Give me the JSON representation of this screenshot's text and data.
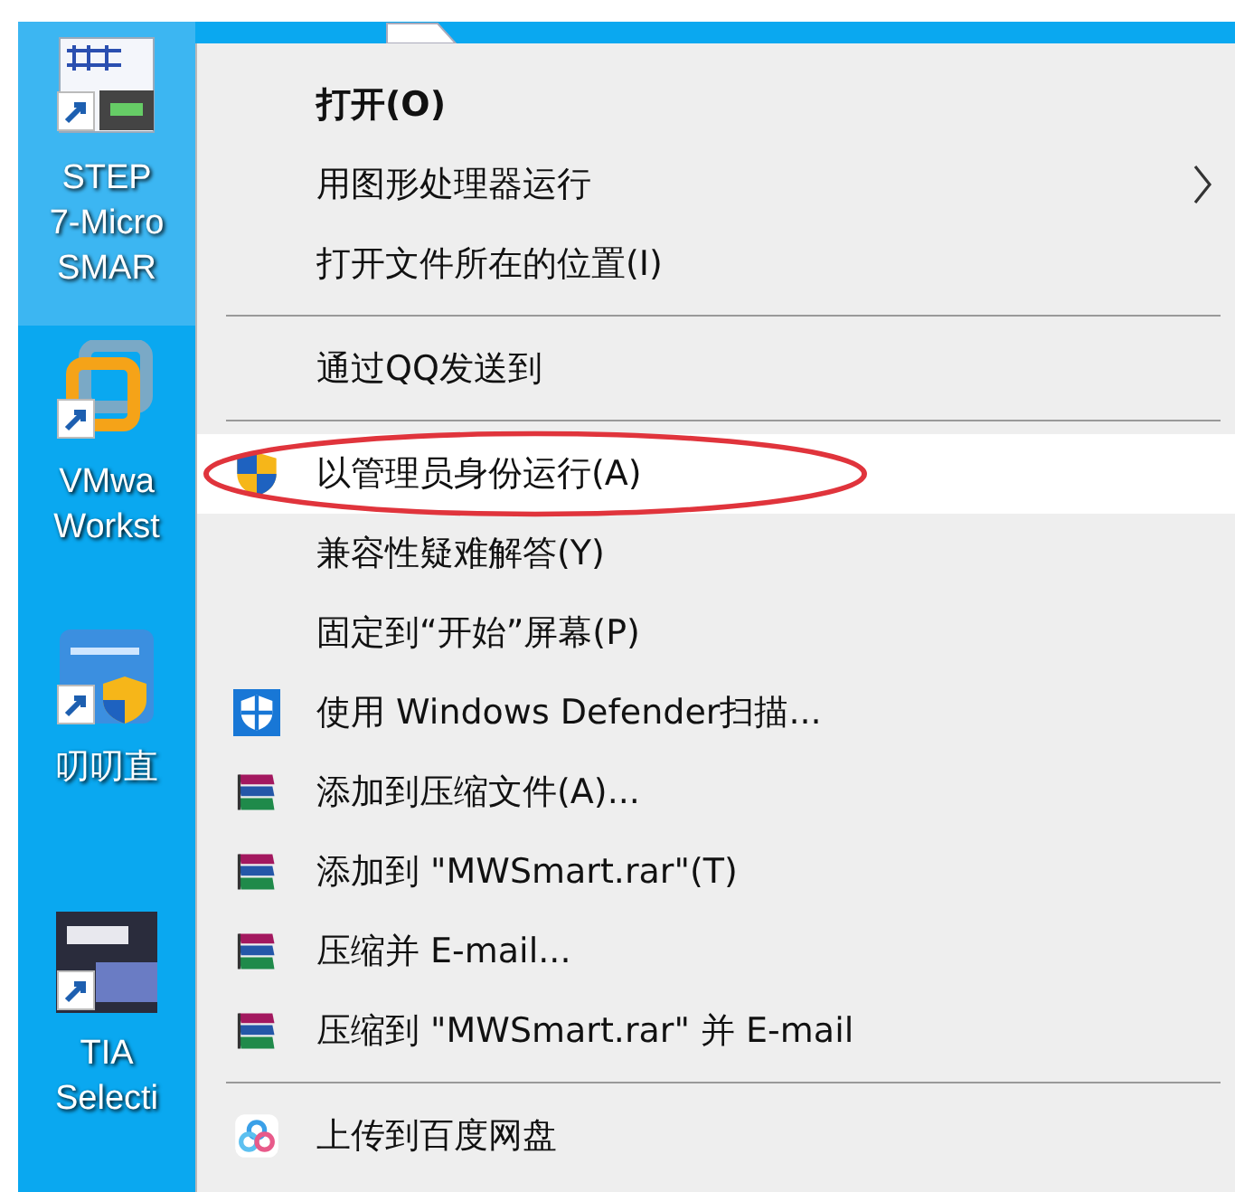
{
  "desktop_icons": [
    {
      "kind": "step7",
      "selected": true,
      "lines": [
        "STEP",
        "7-Micro",
        "SMAR"
      ]
    },
    {
      "kind": "vmware",
      "selected": false,
      "lines": [
        "VMwa",
        "Workst"
      ]
    },
    {
      "kind": "daodao",
      "selected": false,
      "lines": [
        "叨叨直"
      ]
    },
    {
      "kind": "tia",
      "selected": false,
      "lines": [
        "TIA",
        "Selecti"
      ]
    }
  ],
  "context_menu": {
    "sections": [
      {
        "items": [
          {
            "label": "打开(O)",
            "kind": "none",
            "default": true,
            "submenu": false,
            "selected": false
          },
          {
            "label": "用图形处理器运行",
            "kind": "none",
            "default": false,
            "submenu": true,
            "selected": false
          },
          {
            "label": "打开文件所在的位置(I)",
            "kind": "none",
            "default": false,
            "submenu": false,
            "selected": false
          }
        ]
      },
      {
        "items": [
          {
            "label": "通过QQ发送到",
            "kind": "none",
            "default": false,
            "submenu": false,
            "selected": false
          }
        ]
      },
      {
        "items": [
          {
            "label": "以管理员身份运行(A)",
            "kind": "uac",
            "default": false,
            "submenu": false,
            "selected": true
          },
          {
            "label": "兼容性疑难解答(Y)",
            "kind": "none",
            "default": false,
            "submenu": false,
            "selected": false
          },
          {
            "label": "固定到“开始”屏幕(P)",
            "kind": "none",
            "default": false,
            "submenu": false,
            "selected": false
          },
          {
            "label": "使用 Windows Defender扫描...",
            "kind": "defender",
            "default": false,
            "submenu": false,
            "selected": false
          },
          {
            "label": "添加到压缩文件(A)...",
            "kind": "rar",
            "default": false,
            "submenu": false,
            "selected": false
          },
          {
            "label": "添加到 \"MWSmart.rar\"(T)",
            "kind": "rar",
            "default": false,
            "submenu": false,
            "selected": false
          },
          {
            "label": "压缩并 E-mail...",
            "kind": "rar",
            "default": false,
            "submenu": false,
            "selected": false
          },
          {
            "label": "压缩到 \"MWSmart.rar\" 并 E-mail",
            "kind": "rar",
            "default": false,
            "submenu": false,
            "selected": false
          }
        ]
      },
      {
        "items": [
          {
            "label": "上传到百度网盘",
            "kind": "baidu",
            "default": false,
            "submenu": false,
            "selected": false
          }
        ]
      }
    ]
  }
}
